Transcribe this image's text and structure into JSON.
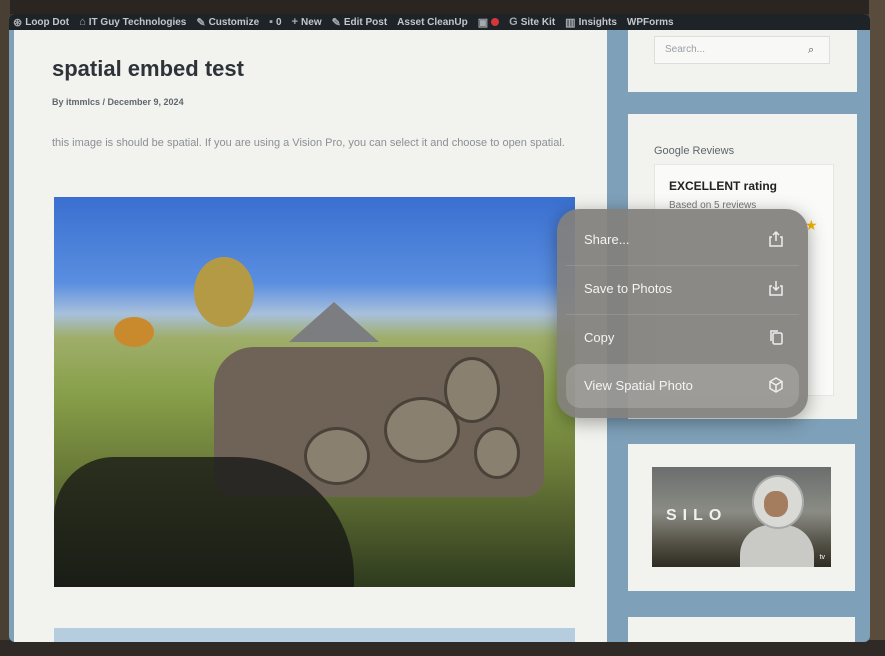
{
  "adminbar": {
    "items": [
      {
        "label": "Loop Dot",
        "icon": "wordpress-icon"
      },
      {
        "label": "IT Guy Technologies",
        "icon": "dashboard-icon"
      },
      {
        "label": "Customize",
        "icon": "brush-icon"
      },
      {
        "label": "0",
        "icon": "comment-icon"
      },
      {
        "label": "New",
        "icon": "plus-icon"
      },
      {
        "label": "Edit Post",
        "icon": "pencil-icon"
      },
      {
        "label": "Asset CleanUp",
        "icon": ""
      },
      {
        "label": "",
        "icon": "record-icon"
      },
      {
        "label": "Site Kit",
        "icon": "google-icon"
      },
      {
        "label": "Insights",
        "icon": "bar-chart-icon"
      },
      {
        "label": "WPForms",
        "icon": ""
      }
    ]
  },
  "post": {
    "title": "spatial embed test",
    "meta": "By itmmlcs / December 9, 2024",
    "body": "this image is should be spatial. If you are using a Vision Pro, you can select it and choose to open spatial."
  },
  "sidebar": {
    "search_placeholder": "Search...",
    "reviews_title": "Google Reviews",
    "rating_title": "EXCELLENT rating",
    "rating_sub": "Based on 5 reviews",
    "silo_text": "SILO",
    "tv_mark": "tv"
  },
  "context_menu": {
    "items": [
      {
        "label": "Share...",
        "icon": "share-icon"
      },
      {
        "label": "Save to Photos",
        "icon": "save-to-photos-icon"
      },
      {
        "label": "Copy",
        "icon": "copy-icon"
      },
      {
        "label": "View Spatial Photo",
        "icon": "cube-icon",
        "highlighted": true
      }
    ]
  },
  "colors": {
    "adminbar_bg": "#1d2327",
    "page_frame": "#7ea0b8",
    "card_bg": "#f2f2ee",
    "menu_bg": "#82807d",
    "star": "#f4b400"
  }
}
